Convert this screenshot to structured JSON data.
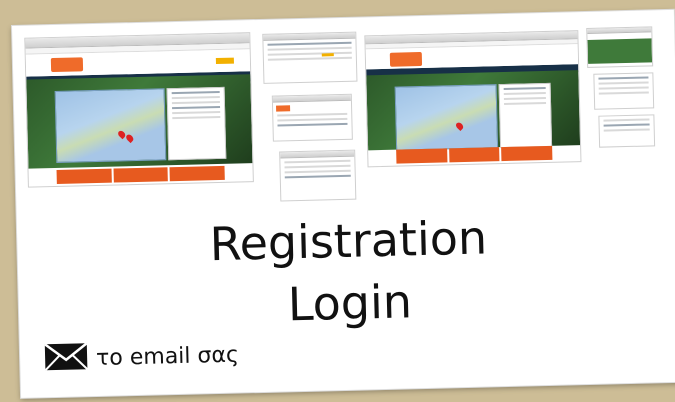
{
  "slide": {
    "title_line1": "Registration",
    "title_line2": "Login",
    "email_text": "το email σας",
    "icon": "envelope-icon"
  },
  "colors": {
    "background": "#cdbd96",
    "accent": "#e75a1f",
    "navy": "#173047"
  }
}
